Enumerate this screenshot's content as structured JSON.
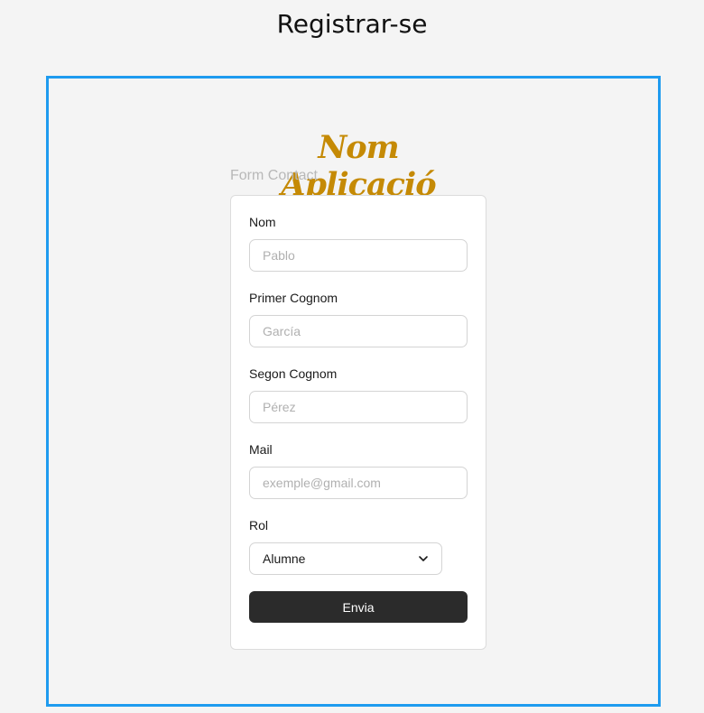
{
  "page": {
    "title": "Registrar-se"
  },
  "app": {
    "name": "Nom Aplicació"
  },
  "form": {
    "caption": "Form Contact",
    "fields": [
      {
        "label": "Nom",
        "placeholder": "Pablo"
      },
      {
        "label": "Primer Cognom",
        "placeholder": "García"
      },
      {
        "label": "Segon Cognom",
        "placeholder": "Pérez"
      },
      {
        "label": "Mail",
        "placeholder": "exemple@gmail.com"
      }
    ],
    "role": {
      "label": "Rol",
      "selected": "Alumne",
      "icon": "chevron-down-icon"
    },
    "submit_label": "Envia"
  },
  "colors": {
    "frame_border": "#1e9bef",
    "app_title": "#c58a05",
    "button_bg": "#2b2b2b",
    "background": "#f4f4f4"
  }
}
